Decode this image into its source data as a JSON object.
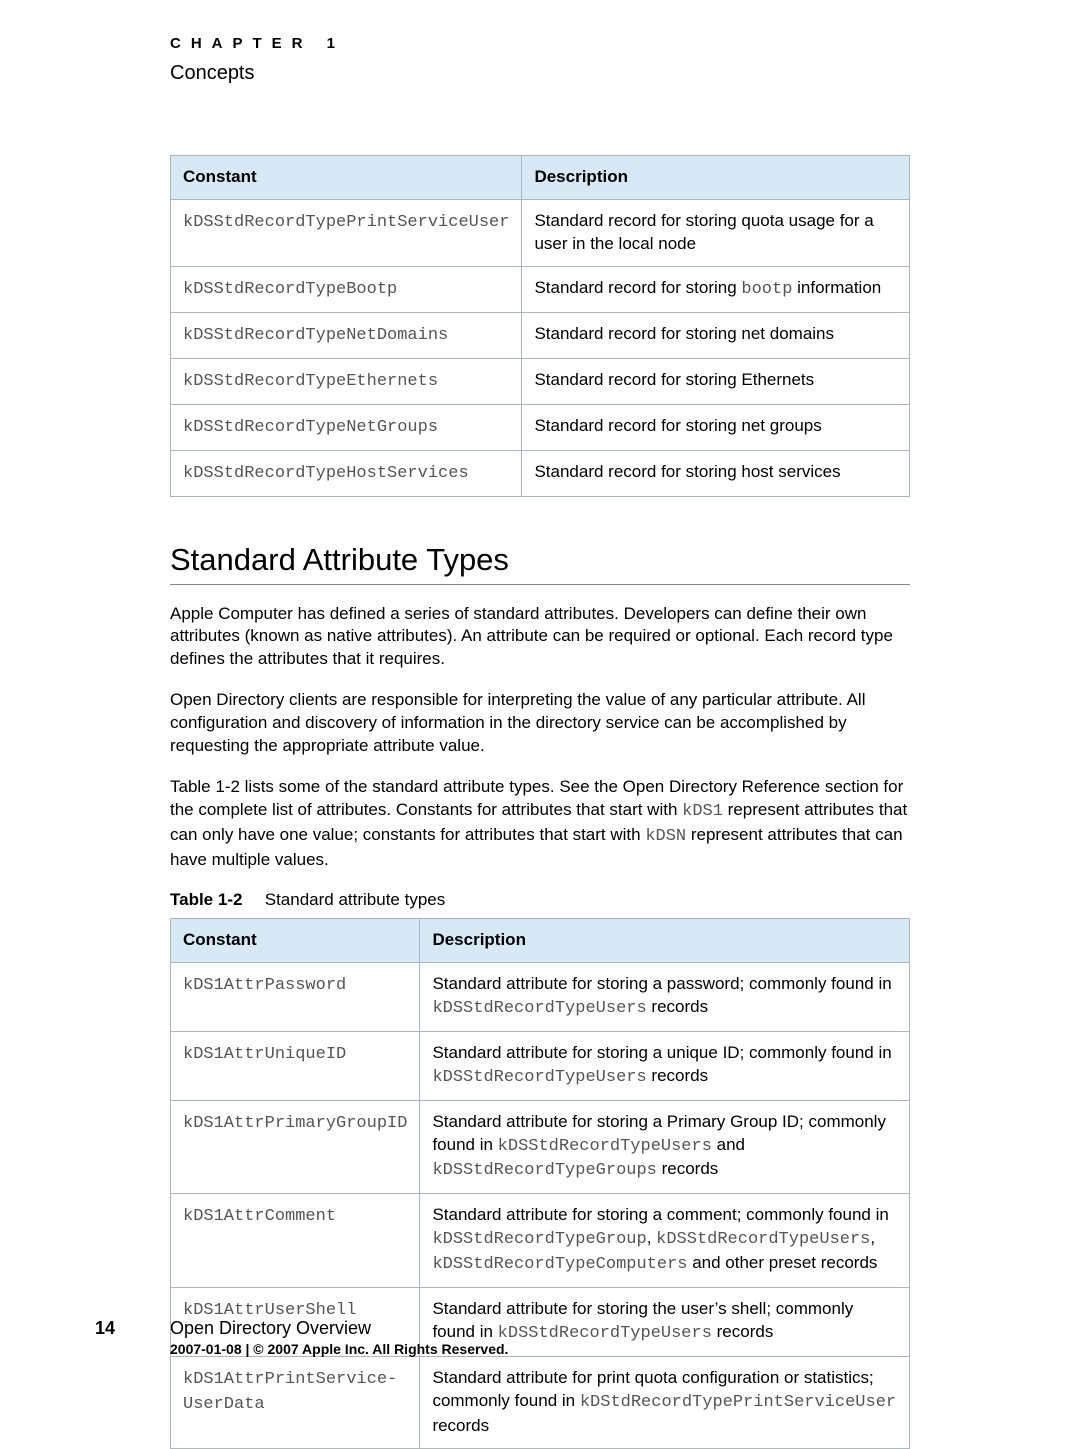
{
  "header": {
    "chapter": "CHAPTER 1",
    "subtitle": "Concepts"
  },
  "table1": {
    "headers": {
      "c1": "Constant",
      "c2": "Description"
    },
    "rows": [
      {
        "constant": "kDSStdRecordTypePrintServiceUser",
        "desc_parts": [
          {
            "t": "Standard record for storing quota usage for a user in the local node"
          }
        ]
      },
      {
        "constant": "kDSStdRecordTypeBootp",
        "desc_parts": [
          {
            "t": "Standard record for storing "
          },
          {
            "t": "bootp",
            "mono": true
          },
          {
            "t": " information"
          }
        ]
      },
      {
        "constant": "kDSStdRecordTypeNetDomains",
        "desc_parts": [
          {
            "t": "Standard record for storing net domains"
          }
        ]
      },
      {
        "constant": "kDSStdRecordTypeEthernets",
        "desc_parts": [
          {
            "t": "Standard record for storing Ethernets"
          }
        ]
      },
      {
        "constant": "kDSStdRecordTypeNetGroups",
        "desc_parts": [
          {
            "t": "Standard record for storing net groups"
          }
        ]
      },
      {
        "constant": "kDSStdRecordTypeHostServices",
        "desc_parts": [
          {
            "t": "Standard record for storing host services"
          }
        ]
      }
    ]
  },
  "section": {
    "title": "Standard Attribute Types",
    "p1": "Apple Computer has defined a series of standard attributes. Developers can define their own attributes (known as native attributes). An attribute can be required or optional. Each record type defines the attributes that it requires.",
    "p2": "Open Directory clients are responsible for interpreting the value of any particular attribute. All configuration and discovery of information in the directory service can be accomplished by requesting the appropriate attribute value.",
    "p3_parts": [
      {
        "t": "Table 1-2 lists some of the standard attribute types. See the Open Directory Reference section for the complete list of attributes. Constants for attributes that start with "
      },
      {
        "t": "kDS1",
        "mono": true
      },
      {
        "t": " represent attributes that can only have one value; constants for attributes that start with "
      },
      {
        "t": "kDSN",
        "mono": true
      },
      {
        "t": " represent attributes that can have multiple values."
      }
    ]
  },
  "table2caption": {
    "lbl": "Table 1-2",
    "title": "Standard attribute types"
  },
  "table2": {
    "headers": {
      "c1": "Constant",
      "c2": "Description"
    },
    "rows": [
      {
        "constant": "kDS1AttrPassword",
        "desc_parts": [
          {
            "t": "Standard attribute for storing a password; commonly found in "
          },
          {
            "t": "kDSStdRecordTypeUsers",
            "mono": true
          },
          {
            "t": " records"
          }
        ]
      },
      {
        "constant": "kDS1AttrUniqueID",
        "desc_parts": [
          {
            "t": "Standard attribute for storing a unique ID; commonly found in "
          },
          {
            "t": "kDSStdRecordTypeUsers",
            "mono": true
          },
          {
            "t": " records"
          }
        ]
      },
      {
        "constant": "kDS1AttrPrimaryGroupID",
        "desc_parts": [
          {
            "t": "Standard attribute for storing a Primary Group ID; commonly found in "
          },
          {
            "t": "kDSStdRecordTypeUsers",
            "mono": true
          },
          {
            "t": " and "
          },
          {
            "t": "kDSStdRecordTypeGroups",
            "mono": true
          },
          {
            "t": " records"
          }
        ]
      },
      {
        "constant": "kDS1AttrComment",
        "desc_parts": [
          {
            "t": "Standard attribute for storing a comment; commonly found in "
          },
          {
            "t": "kDSStdRecordTypeGroup",
            "mono": true
          },
          {
            "t": ", "
          },
          {
            "t": "kDSStdRecordTypeUsers",
            "mono": true
          },
          {
            "t": ", "
          },
          {
            "t": "kDSStdRecordTypeComputers",
            "mono": true
          },
          {
            "t": " and other preset records"
          }
        ]
      },
      {
        "constant": "kDS1AttrUserShell",
        "desc_parts": [
          {
            "t": "Standard attribute for storing the user’s shell; commonly found in "
          },
          {
            "t": "kDSStdRecordTypeUsers",
            "mono": true
          },
          {
            "t": " records"
          }
        ]
      },
      {
        "constant": "kDS1AttrPrintService-\nUserData",
        "desc_parts": [
          {
            "t": "Standard attribute for print quota configuration or statistics; commonly found in "
          },
          {
            "t": "kDStdRecordTypePrintServiceUser",
            "mono": true
          },
          {
            "t": " records"
          }
        ]
      }
    ]
  },
  "footer": {
    "page_number": "14",
    "line1": "Open Directory Overview",
    "line2": "2007-01-08   |   © 2007 Apple Inc. All Rights Reserved."
  }
}
